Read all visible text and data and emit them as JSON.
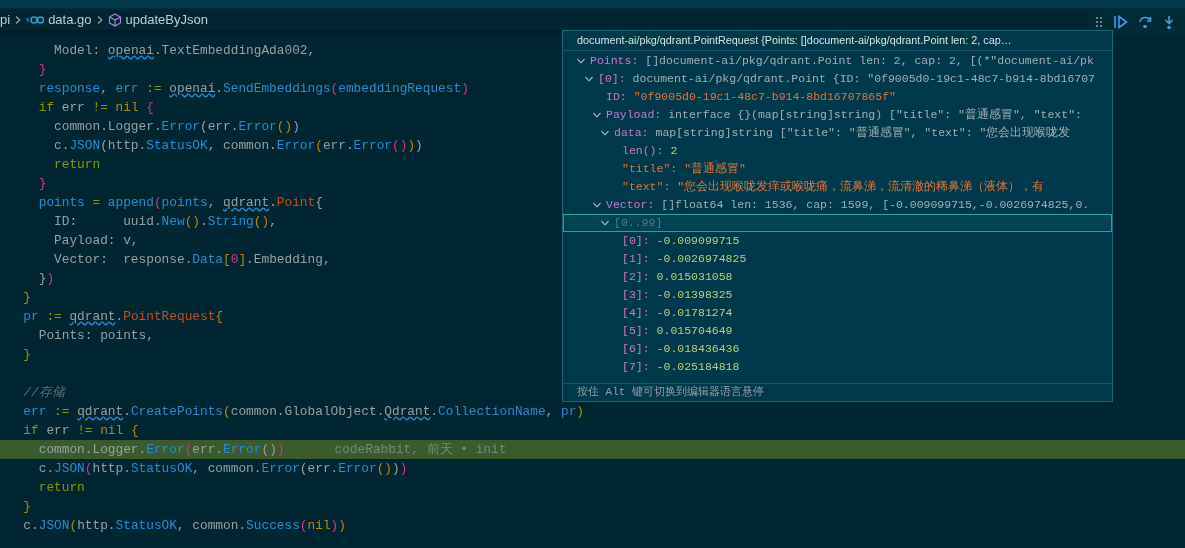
{
  "breadcrumb": [
    {
      "kind": "folder",
      "label": "pi"
    },
    {
      "kind": "go-file",
      "label": "data.go"
    },
    {
      "kind": "symbol",
      "label": "updateByJson"
    }
  ],
  "code_lines": [
    {
      "kind": "code",
      "tokens": [
        {
          "text": "      Model: ",
          "kind": "plain"
        },
        {
          "text": "openai",
          "kind": "warning"
        },
        {
          "text": ".TextEmbeddingAda002,",
          "kind": "plain"
        }
      ]
    },
    {
      "kind": "code",
      "tokens": [
        {
          "text": "    }",
          "kind": "bracket2"
        }
      ]
    },
    {
      "kind": "code",
      "tokens": [
        {
          "text": "    response",
          "kind": "variable"
        },
        {
          "text": ", ",
          "kind": "plain"
        },
        {
          "text": "err",
          "kind": "variable"
        },
        {
          "text": " := ",
          "kind": "operator"
        },
        {
          "text": "openai",
          "kind": "warning"
        },
        {
          "text": ".",
          "kind": "plain"
        },
        {
          "text": "SendEmbeddings",
          "kind": "function"
        },
        {
          "text": "(",
          "kind": "bracket2"
        },
        {
          "text": "embeddingRequest",
          "kind": "variable"
        },
        {
          "text": ")",
          "kind": "bracket2"
        }
      ]
    },
    {
      "kind": "code",
      "tokens": [
        {
          "text": "    if",
          "kind": "keyword"
        },
        {
          "text": " err ",
          "kind": "plain"
        },
        {
          "text": "!=",
          "kind": "operator"
        },
        {
          "text": " nil",
          "kind": "literal"
        },
        {
          "text": " {",
          "kind": "bracket2"
        }
      ]
    },
    {
      "kind": "code",
      "tokens": [
        {
          "text": "      common.Logger.",
          "kind": "plain"
        },
        {
          "text": "Error",
          "kind": "function"
        },
        {
          "text": "(err.",
          "kind": "plain"
        },
        {
          "text": "Error",
          "kind": "function"
        },
        {
          "text": "()",
          "kind": "bracket1"
        },
        {
          "text": ")",
          "kind": "plain"
        }
      ]
    },
    {
      "kind": "code",
      "tokens": [
        {
          "text": "      c.",
          "kind": "plain"
        },
        {
          "text": "JSON",
          "kind": "function"
        },
        {
          "text": "(http.",
          "kind": "plain"
        },
        {
          "text": "StatusOK",
          "kind": "function"
        },
        {
          "text": ", common.",
          "kind": "plain"
        },
        {
          "text": "Error",
          "kind": "function"
        },
        {
          "text": "(",
          "kind": "bracket1"
        },
        {
          "text": "err.",
          "kind": "plain"
        },
        {
          "text": "Error",
          "kind": "function"
        },
        {
          "text": "()",
          "kind": "bracket2"
        },
        {
          "text": ")",
          "kind": "bracket1"
        },
        {
          "text": ")",
          "kind": "plain"
        }
      ]
    },
    {
      "kind": "code",
      "tokens": [
        {
          "text": "      return",
          "kind": "keyword"
        }
      ]
    },
    {
      "kind": "code",
      "tokens": [
        {
          "text": "    }",
          "kind": "bracket2"
        }
      ]
    },
    {
      "kind": "code",
      "tokens": [
        {
          "text": "    points",
          "kind": "variable"
        },
        {
          "text": " = ",
          "kind": "operator"
        },
        {
          "text": "append",
          "kind": "function"
        },
        {
          "text": "(",
          "kind": "bracket2"
        },
        {
          "text": "points",
          "kind": "variable"
        },
        {
          "text": ", ",
          "kind": "plain"
        },
        {
          "text": "qdrant",
          "kind": "warning"
        },
        {
          "text": ".",
          "kind": "plain"
        },
        {
          "text": "Point",
          "kind": "type"
        },
        {
          "text": "{",
          "kind": "plain"
        }
      ]
    },
    {
      "kind": "code",
      "tokens": [
        {
          "text": "      ID:      uuid.",
          "kind": "plain"
        },
        {
          "text": "New",
          "kind": "function"
        },
        {
          "text": "()",
          "kind": "bracket1"
        },
        {
          "text": ".",
          "kind": "plain"
        },
        {
          "text": "String",
          "kind": "function"
        },
        {
          "text": "()",
          "kind": "bracket1"
        },
        {
          "text": ",",
          "kind": "plain"
        }
      ]
    },
    {
      "kind": "code",
      "tokens": [
        {
          "text": "      Payload: v,",
          "kind": "plain"
        }
      ]
    },
    {
      "kind": "code",
      "tokens": [
        {
          "text": "      Vector:  response.",
          "kind": "plain"
        },
        {
          "text": "Data",
          "kind": "function"
        },
        {
          "text": "[",
          "kind": "bracket1"
        },
        {
          "text": "0",
          "kind": "number"
        },
        {
          "text": "]",
          "kind": "bracket1"
        },
        {
          "text": ".Embedding,",
          "kind": "plain"
        }
      ]
    },
    {
      "kind": "code",
      "tokens": [
        {
          "text": "    }",
          "kind": "plain"
        },
        {
          "text": ")",
          "kind": "bracket2"
        }
      ]
    },
    {
      "kind": "code",
      "tokens": [
        {
          "text": "  }",
          "kind": "bracket1"
        }
      ]
    },
    {
      "kind": "code",
      "tokens": [
        {
          "text": "  pr",
          "kind": "variable"
        },
        {
          "text": " := ",
          "kind": "operator"
        },
        {
          "text": "qdrant",
          "kind": "warning"
        },
        {
          "text": ".",
          "kind": "plain"
        },
        {
          "text": "PointRequest",
          "kind": "type"
        },
        {
          "text": "{",
          "kind": "bracket1"
        }
      ]
    },
    {
      "kind": "code",
      "tokens": [
        {
          "text": "    Points: points,",
          "kind": "plain"
        }
      ]
    },
    {
      "kind": "code",
      "tokens": [
        {
          "text": "  }",
          "kind": "bracket1"
        }
      ]
    },
    {
      "kind": "blank"
    },
    {
      "kind": "code",
      "tokens": [
        {
          "text": "  //存储",
          "kind": "comment"
        }
      ]
    },
    {
      "kind": "code",
      "tokens": [
        {
          "text": "  err",
          "kind": "variable"
        },
        {
          "text": " := ",
          "kind": "operator"
        },
        {
          "text": "qdrant",
          "kind": "warning"
        },
        {
          "text": ".",
          "kind": "plain"
        },
        {
          "text": "CreatePoints",
          "kind": "function"
        },
        {
          "text": "(",
          "kind": "bracket1"
        },
        {
          "text": "common.GlobalObject.",
          "kind": "plain"
        },
        {
          "text": "Qdrant",
          "kind": "warning"
        },
        {
          "text": ".",
          "kind": "plain"
        },
        {
          "text": "CollectionName",
          "kind": "function"
        },
        {
          "text": ", ",
          "kind": "plain"
        },
        {
          "text": "pr",
          "kind": "variable"
        },
        {
          "text": ")",
          "kind": "bracket1"
        }
      ]
    },
    {
      "kind": "code",
      "tokens": [
        {
          "text": "  if",
          "kind": "keyword"
        },
        {
          "text": " err ",
          "kind": "plain"
        },
        {
          "text": "!=",
          "kind": "operator"
        },
        {
          "text": " nil ",
          "kind": "literal"
        },
        {
          "text": "{",
          "kind": "bracket1"
        }
      ]
    },
    {
      "kind": "code",
      "highlighted": true,
      "blame": "codeRabbit, 前天 • init",
      "tokens": [
        {
          "text": "    common.Logger.",
          "kind": "plain"
        },
        {
          "text": "Error",
          "kind": "function"
        },
        {
          "text": "(",
          "kind": "bracket2"
        },
        {
          "text": "err.",
          "kind": "plain"
        },
        {
          "text": "Error",
          "kind": "function"
        },
        {
          "text": "()",
          "kind": "plain"
        },
        {
          "text": ")",
          "kind": "bracket2"
        }
      ]
    },
    {
      "kind": "code",
      "tokens": [
        {
          "text": "    c.",
          "kind": "plain"
        },
        {
          "text": "JSON",
          "kind": "function"
        },
        {
          "text": "(",
          "kind": "bracket2"
        },
        {
          "text": "http.",
          "kind": "plain"
        },
        {
          "text": "StatusOK",
          "kind": "function"
        },
        {
          "text": ", common.",
          "kind": "plain"
        },
        {
          "text": "Error",
          "kind": "function"
        },
        {
          "text": "(err.",
          "kind": "plain"
        },
        {
          "text": "Error",
          "kind": "function"
        },
        {
          "text": "()",
          "kind": "bracket1"
        },
        {
          "text": ")",
          "kind": "plain"
        },
        {
          "text": ")",
          "kind": "bracket2"
        }
      ]
    },
    {
      "kind": "code",
      "tokens": [
        {
          "text": "    return",
          "kind": "keyword"
        }
      ]
    },
    {
      "kind": "code",
      "tokens": [
        {
          "text": "  }",
          "kind": "bracket1"
        }
      ]
    },
    {
      "kind": "code",
      "tokens": [
        {
          "text": "  c.",
          "kind": "plain"
        },
        {
          "text": "JSON",
          "kind": "function"
        },
        {
          "text": "(",
          "kind": "bracket1"
        },
        {
          "text": "http.",
          "kind": "plain"
        },
        {
          "text": "StatusOK",
          "kind": "function"
        },
        {
          "text": ", common.",
          "kind": "plain"
        },
        {
          "text": "Success",
          "kind": "function"
        },
        {
          "text": "(",
          "kind": "bracket2"
        },
        {
          "text": "nil",
          "kind": "literal"
        },
        {
          "text": ")",
          "kind": "bracket2"
        },
        {
          "text": ")",
          "kind": "bracket1"
        }
      ]
    }
  ],
  "hover": {
    "header": "document-ai/pkg/qdrant.PointRequest {Points: []document-ai/pkg/qdrant.Point len: 2, cap…",
    "tree": [
      {
        "key": {
          "text": "Points:",
          "kind": "field"
        },
        "value": {
          "text": "[]document-ai/pkg/qdrant.Point len: 2, cap: 2, [(*\"document-ai/pk",
          "kind": "type"
        },
        "expanded": true,
        "selected": false,
        "children": [
          {
            "key": {
              "text": "[0]:",
              "kind": "index"
            },
            "value": {
              "text": "document-ai/pkg/qdrant.Point {ID: \"0f9005d0-19c1-48c7-b914-8bd16707",
              "kind": "type"
            },
            "expanded": true,
            "selected": false,
            "children": [
              {
                "key": {
                  "text": "ID:",
                  "kind": "field"
                },
                "value": {
                  "text": "\"0f9005d0-19c1-48c7-b914-8bd16707865f\"",
                  "kind": "string"
                },
                "selected": false
              },
              {
                "key": {
                  "text": "Payload:",
                  "kind": "field"
                },
                "value": {
                  "text": "interface {}(map[string]string) [\"title\": \"普通感冒\", \"text\":",
                  "kind": "type"
                },
                "expanded": true,
                "selected": false,
                "children": [
                  {
                    "key": {
                      "text": "data:",
                      "kind": "field"
                    },
                    "value": {
                      "text": "map[string]string [\"title\": \"普通感冒\", \"text\": \"您会出现喉咙发",
                      "kind": "type"
                    },
                    "expanded": true,
                    "selected": false,
                    "children": [
                      {
                        "key": {
                          "text": "len():",
                          "kind": "field"
                        },
                        "value": {
                          "text": "2",
                          "kind": "number"
                        },
                        "selected": false
                      },
                      {
                        "key": {
                          "text": "\"title\":",
                          "kind": "mapkey"
                        },
                        "value": {
                          "text": "\"普通感冒\"",
                          "kind": "string"
                        },
                        "selected": false
                      },
                      {
                        "key": {
                          "text": "\"text\":",
                          "kind": "mapkey"
                        },
                        "value": {
                          "text": "\"您会出现喉咙发痒或喉咙痛，流鼻涕，流清澈的稀鼻涕（液体），有",
                          "kind": "string"
                        },
                        "selected": false
                      }
                    ]
                  }
                ]
              },
              {
                "key": {
                  "text": "Vector:",
                  "kind": "field"
                },
                "value": {
                  "text": "[]float64 len: 1536, cap: 1599, [-0.009099715,-0.0026974825,0.",
                  "kind": "type"
                },
                "expanded": true,
                "selected": false,
                "children": [
                  {
                    "key": {
                      "text": "[0..99]",
                      "kind": "range"
                    },
                    "expanded": true,
                    "selected": true,
                    "children": [
                      {
                        "key": {
                          "text": "[0]:",
                          "kind": "index"
                        },
                        "value": {
                          "text": "-0.009099715",
                          "kind": "number"
                        },
                        "selected": false
                      },
                      {
                        "key": {
                          "text": "[1]:",
                          "kind": "index"
                        },
                        "value": {
                          "text": "-0.0026974825",
                          "kind": "number"
                        },
                        "selected": false
                      },
                      {
                        "key": {
                          "text": "[2]:",
                          "kind": "index"
                        },
                        "value": {
                          "text": "0.015031058",
                          "kind": "number"
                        },
                        "selected": false
                      },
                      {
                        "key": {
                          "text": "[3]:",
                          "kind": "index"
                        },
                        "value": {
                          "text": "-0.01398325",
                          "kind": "number"
                        },
                        "selected": false
                      },
                      {
                        "key": {
                          "text": "[4]:",
                          "kind": "index"
                        },
                        "value": {
                          "text": "-0.01781274",
                          "kind": "number"
                        },
                        "selected": false
                      },
                      {
                        "key": {
                          "text": "[5]:",
                          "kind": "index"
                        },
                        "value": {
                          "text": "0.015704649",
                          "kind": "number"
                        },
                        "selected": false
                      },
                      {
                        "key": {
                          "text": "[6]:",
                          "kind": "index"
                        },
                        "value": {
                          "text": "-0.018436436",
                          "kind": "number"
                        },
                        "selected": false
                      },
                      {
                        "key": {
                          "text": "[7]:",
                          "kind": "index"
                        },
                        "value": {
                          "text": "-0.025184818",
                          "kind": "number"
                        },
                        "selected": false
                      }
                    ]
                  }
                ]
              }
            ]
          }
        ]
      }
    ],
    "footer": "按住 Alt 键可切换到编辑器语言悬停"
  }
}
